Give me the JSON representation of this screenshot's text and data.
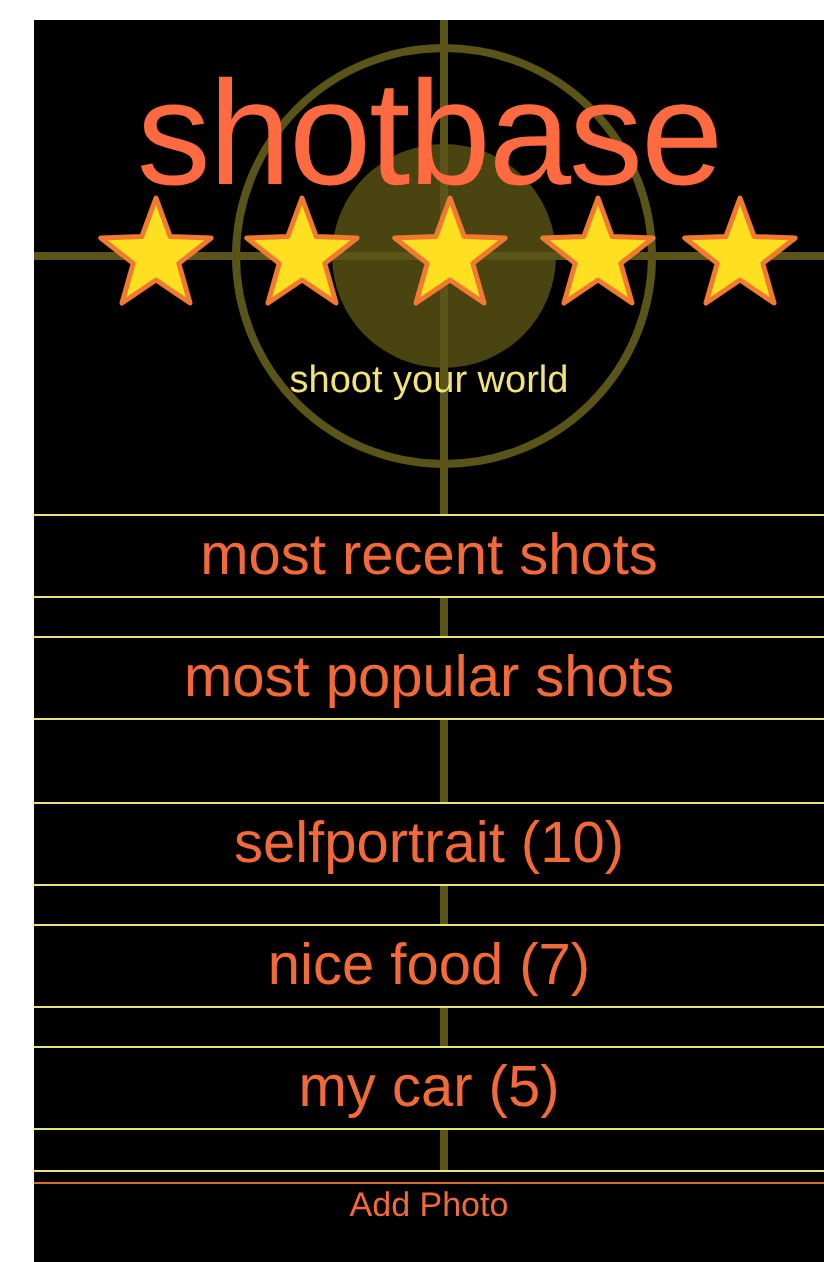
{
  "logo": {
    "title": "shotbase",
    "slogan": "shoot your world"
  },
  "menu": [
    {
      "label": "most recent shots"
    },
    {
      "label": "most popular shots"
    }
  ],
  "albums": [
    {
      "label": "selfportrait (10)"
    },
    {
      "label": "nice food (7)"
    },
    {
      "label": "my car (5)"
    }
  ],
  "footer": {
    "label": "Add Photo"
  }
}
